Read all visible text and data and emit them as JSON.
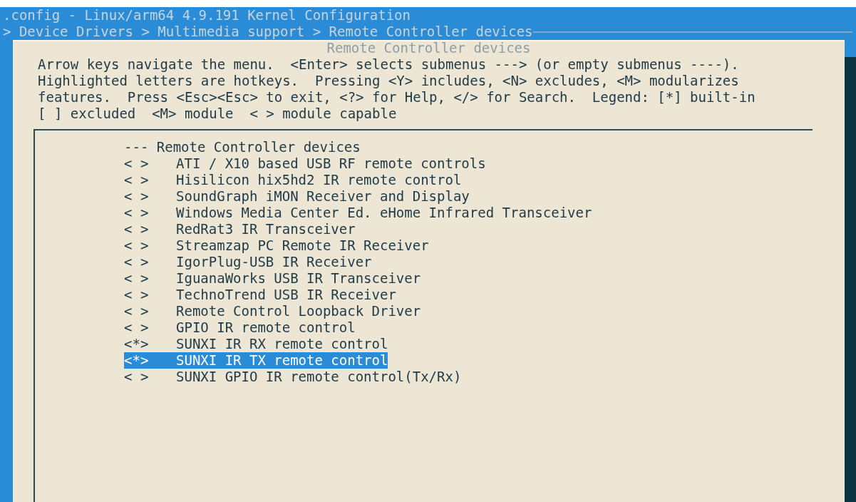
{
  "window": {
    "title": ".config - Linux/arm64 4.9.191 Kernel Configuration"
  },
  "breadcrumb": "> Device Drivers > Multimedia support > Remote Controller devices",
  "dialog": {
    "title": "Remote Controller devices",
    "help": [
      "Arrow keys navigate the menu.  <Enter> selects submenus ---> (or empty submenus ----).",
      "Highlighted letters are hotkeys.  Pressing <Y> includes, <N> excludes, <M> modularizes",
      "features.  Press <Esc><Esc> to exit, <?> for Help, </> for Search.  Legend: [*] built-in",
      "[ ] excluded  <M> module  < > module capable"
    ],
    "menu_header": "--- Remote Controller devices",
    "items": [
      {
        "value": "< >",
        "label": "ATI / X10 based USB RF remote controls",
        "selected": false
      },
      {
        "value": "< >",
        "label": "Hisilicon hix5hd2 IR remote control",
        "selected": false
      },
      {
        "value": "< >",
        "label": "SoundGraph iMON Receiver and Display",
        "selected": false
      },
      {
        "value": "< >",
        "label": "Windows Media Center Ed. eHome Infrared Transceiver",
        "selected": false
      },
      {
        "value": "< >",
        "label": "RedRat3 IR Transceiver",
        "selected": false
      },
      {
        "value": "< >",
        "label": "Streamzap PC Remote IR Receiver",
        "selected": false
      },
      {
        "value": "< >",
        "label": "IgorPlug-USB IR Receiver",
        "selected": false
      },
      {
        "value": "< >",
        "label": "IguanaWorks USB IR Transceiver",
        "selected": false
      },
      {
        "value": "< >",
        "label": "TechnoTrend USB IR Receiver",
        "selected": false
      },
      {
        "value": "< >",
        "label": "Remote Control Loopback Driver",
        "selected": false
      },
      {
        "value": "< >",
        "label": "GPIO IR remote control",
        "selected": false
      },
      {
        "value": "<*>",
        "label": "SUNXI IR RX remote control",
        "selected": false
      },
      {
        "value": "<*>",
        "label": "SUNXI IR TX remote control",
        "selected": true
      },
      {
        "value": "< >",
        "label": "SUNXI GPIO IR remote control(Tx/Rx)",
        "selected": false
      }
    ]
  }
}
